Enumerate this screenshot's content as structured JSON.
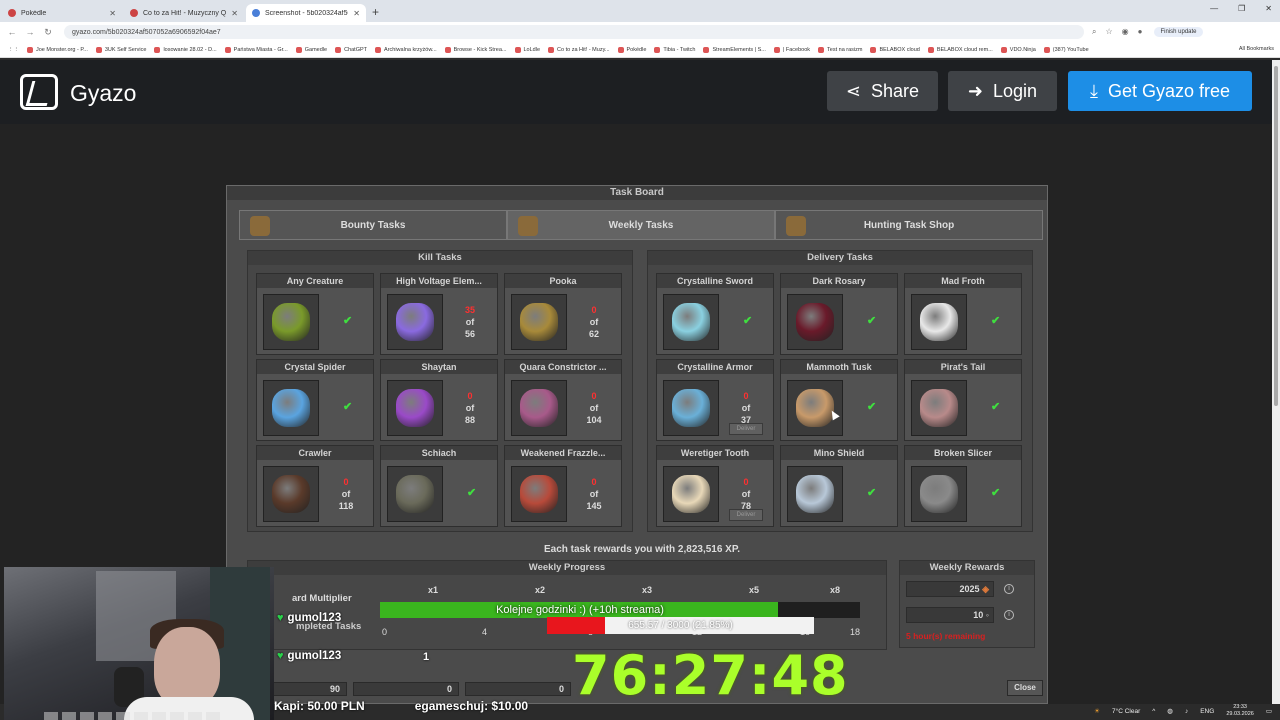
{
  "browser": {
    "tabs": [
      {
        "label": "Pokédle",
        "active": false
      },
      {
        "label": "Co to za Hit! - Muzyczny Q",
        "active": false
      },
      {
        "label": "Screenshot - 5b020324af50705",
        "active": true
      }
    ],
    "url": "gyazo.com/5b020324af507052a6906592f04ae7",
    "finish_update": "Finish update",
    "bookmarks": [
      "Joe Monster.org - P...",
      "3UK Self Service",
      "losowanie 28.02 - D...",
      "Państwa Miasta - Gr...",
      "Gamedle",
      "ChatGPT",
      "Archiwalna krzyżów...",
      "Browse - Kick Strea...",
      "LoLdle",
      "Co to za Hit! - Muzy...",
      "Pokédle",
      "Tibia - Twitch",
      "StreamElements | S...",
      "| Facebook",
      "Test na rasizm",
      "BELABOX cloud",
      "BELABOX cloud rem...",
      "VDO.Ninja",
      "(387) YouTube"
    ],
    "all_bookmarks": "All Bookmarks"
  },
  "gyazo": {
    "brand": "Gyazo",
    "share": "Share",
    "login": "Login",
    "get": "Get Gyazo free"
  },
  "board": {
    "title": "Task Board",
    "tabs": [
      "Bounty Tasks",
      "Weekly Tasks",
      "Hunting Task Shop"
    ],
    "kill_title": "Kill Tasks",
    "delivery_title": "Delivery Tasks",
    "of": "of",
    "deliver": "Deliver",
    "kill": [
      {
        "name": "Any Creature",
        "done": true,
        "color": "#7a9a2a"
      },
      {
        "name": "High Voltage Elem...",
        "done": false,
        "current": "35",
        "total": "56",
        "color": "#8a6ae0"
      },
      {
        "name": "Pooka",
        "done": false,
        "current": "0",
        "total": "62",
        "color": "#a88a3a"
      },
      {
        "name": "Crystal Spider",
        "done": true,
        "color": "#5aa4e0"
      },
      {
        "name": "Shaytan",
        "done": false,
        "current": "0",
        "total": "88",
        "color": "#9a4ac8"
      },
      {
        "name": "Quara Constrictor ...",
        "done": false,
        "current": "0",
        "total": "104",
        "color": "#a85a8a"
      },
      {
        "name": "Crawler",
        "done": false,
        "current": "0",
        "total": "118",
        "color": "#5a3a2a"
      },
      {
        "name": "Schiach",
        "done": true,
        "color": "#6a6a5a"
      },
      {
        "name": "Weakened Frazzle...",
        "done": false,
        "current": "0",
        "total": "145",
        "color": "#b84a3a"
      }
    ],
    "delivery": [
      {
        "name": "Crystalline Sword",
        "done": true,
        "color": "#8ad0e0"
      },
      {
        "name": "Dark Rosary",
        "done": true,
        "color": "#6a1a2a"
      },
      {
        "name": "Mad Froth",
        "done": true,
        "color": "#e8e8e8"
      },
      {
        "name": "Crystalline Armor",
        "done": false,
        "current": "0",
        "total": "37",
        "color": "#6ab0d8"
      },
      {
        "name": "Mammoth Tusk",
        "done": true,
        "color": "#c89a6a"
      },
      {
        "name": "Pirat's Tail",
        "done": true,
        "color": "#b88a8a"
      },
      {
        "name": "Weretiger Tooth",
        "done": false,
        "current": "0",
        "total": "78",
        "color": "#e8d8b8"
      },
      {
        "name": "Mino Shield",
        "done": true,
        "color": "#b8c8d8"
      },
      {
        "name": "Broken Slicer",
        "done": true,
        "color": "#8a8a8a"
      }
    ],
    "reward_text": "Each task rewards you with 2,823,516 XP.",
    "weekly_progress": "Weekly Progress",
    "multipliers": [
      "x1",
      "x2",
      "x3",
      "x5",
      "x8"
    ],
    "reward_multiplier": "ard Multiplier",
    "completed_tasks": "mpleted Tasks",
    "ticks": [
      "0",
      "4",
      "8",
      "12",
      "16",
      "18"
    ],
    "weekly_rewards": "Weekly Rewards",
    "reward_points": "2025",
    "reward_soul": "10",
    "remaining": "5 hour(s) remaining",
    "bottom_values": [
      "90",
      "0",
      "0"
    ],
    "close": "Close"
  },
  "stream": {
    "supporters": [
      {
        "name": "gumol123",
        "count": ""
      },
      {
        "name": "gumol123",
        "count": "1"
      }
    ],
    "goal_text": "Kolejne godzinki :) (+10h streama)",
    "goal_progress": 0.83,
    "sub_text": "655.57 / 3000 (21.85%)",
    "sub_progress": 0.2185,
    "timer": "76:27:48",
    "donations": [
      "Kapi: 50.00 PLN",
      "egameschuj: $10.00"
    ]
  },
  "tray": {
    "weather": "7°C Clear",
    "lang": "ENG",
    "time": "23:33",
    "date": "29.03.2026"
  }
}
